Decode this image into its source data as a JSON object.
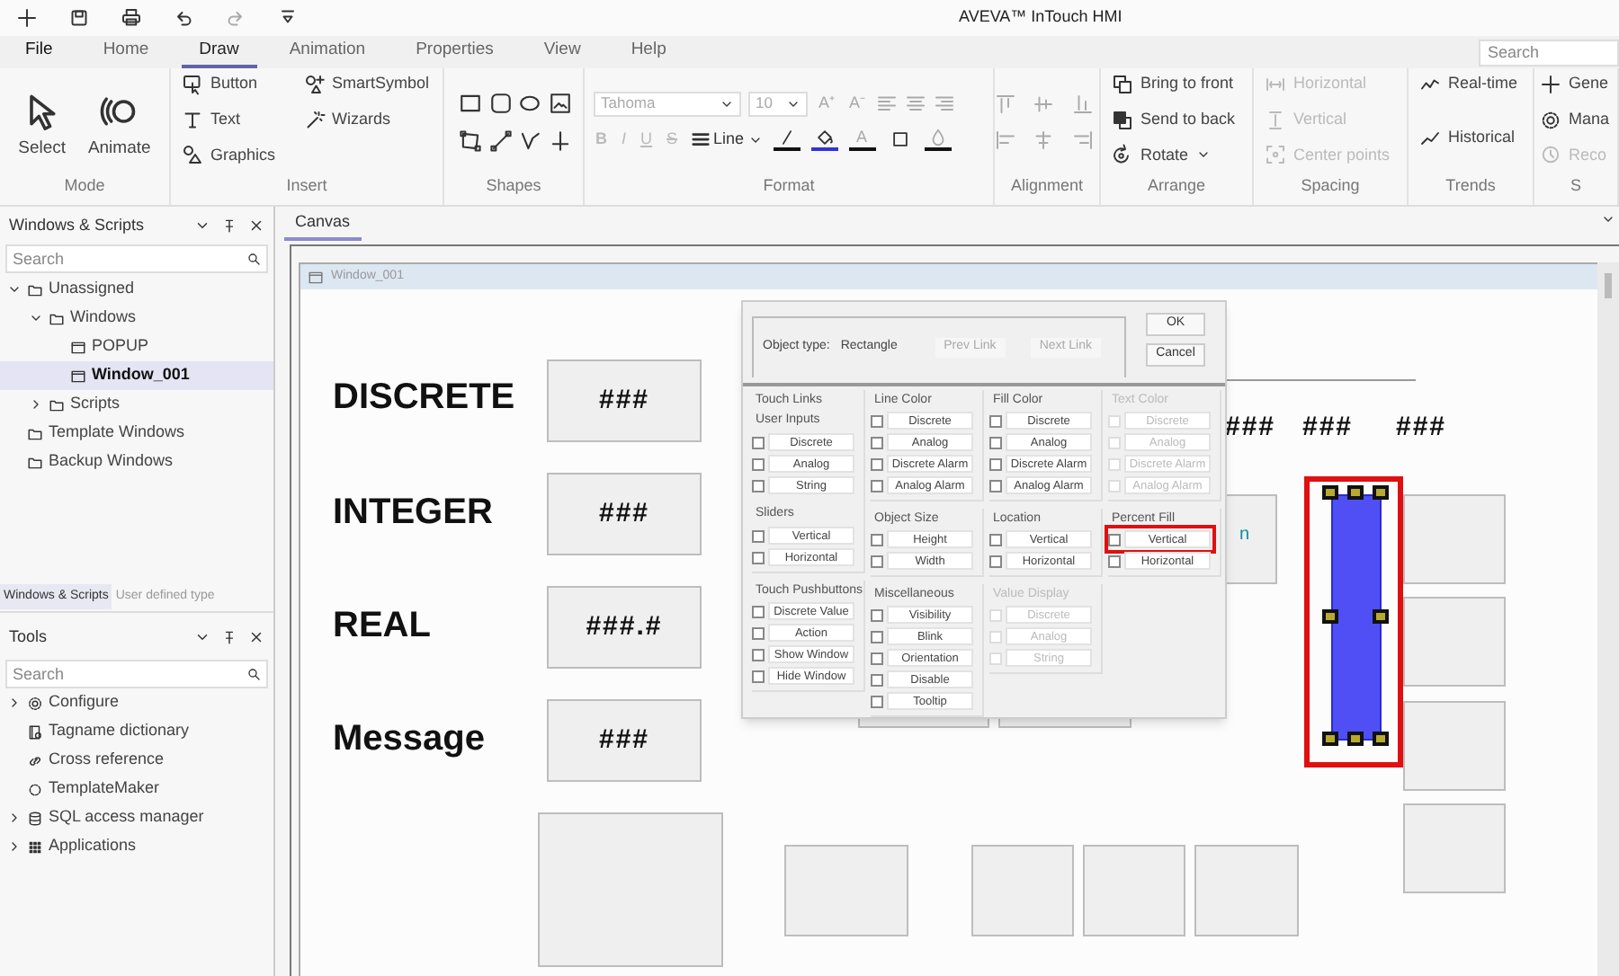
{
  "title": "AVEVA™ InTouch HMI",
  "menu_tabs": [
    {
      "label": "File",
      "selected": false
    },
    {
      "label": "Home",
      "selected": false
    },
    {
      "label": "Draw",
      "selected": true
    },
    {
      "label": "Animation",
      "selected": false
    },
    {
      "label": "Properties",
      "selected": false
    },
    {
      "label": "View",
      "selected": false
    },
    {
      "label": "Help",
      "selected": false
    }
  ],
  "ribbon_search": {
    "placeholder": "Search"
  },
  "ribbon_groups": [
    {
      "label": "Mode",
      "kind": "big",
      "items": [
        {
          "label": "Select",
          "disabled": false
        },
        {
          "label": "Animate",
          "disabled": false
        }
      ]
    },
    {
      "label": "Insert",
      "kind": "list2",
      "items": [
        {
          "label": "Button",
          "disabled": false
        },
        {
          "label": "Text",
          "disabled": false
        },
        {
          "label": "Graphics",
          "disabled": false
        },
        {
          "label": "SmartSymbol",
          "disabled": false
        },
        {
          "label": "Wizards",
          "disabled": false
        }
      ]
    },
    {
      "label": "Shapes",
      "kind": "shapes"
    },
    {
      "label": "Format",
      "kind": "format",
      "font": "Tahoma",
      "size": "10",
      "font_size_buttons": [
        "A⁺",
        "A⁻"
      ],
      "style_buttons": [
        "B",
        "I",
        "U",
        "S"
      ],
      "line": "Line",
      "text_color_button": "A"
    },
    {
      "label": "Alignment",
      "kind": "align"
    },
    {
      "label": "Arrange",
      "kind": "list",
      "items": [
        {
          "label": "Bring to front",
          "disabled": false
        },
        {
          "label": "Send to back",
          "disabled": false
        },
        {
          "label": "Rotate",
          "disabled": false
        }
      ]
    },
    {
      "label": "Spacing",
      "kind": "list",
      "items": [
        {
          "label": "Horizontal",
          "disabled": true
        },
        {
          "label": "Vertical",
          "disabled": true
        },
        {
          "label": "Center points",
          "disabled": true
        }
      ]
    },
    {
      "label": "Trends",
      "kind": "list",
      "items": [
        {
          "label": "Real-time",
          "disabled": false
        },
        {
          "label": "Historical",
          "disabled": false
        }
      ]
    },
    {
      "label": "S",
      "kind": "list",
      "items": [
        {
          "label": "Gene",
          "disabled": false
        },
        {
          "label": "Mana",
          "disabled": false
        },
        {
          "label": "Reco",
          "disabled": true
        }
      ]
    }
  ],
  "windows_panel": {
    "title": "Windows & Scripts",
    "search": {
      "placeholder": "Search"
    },
    "tree": [
      {
        "label": "Unassigned",
        "expanded": true,
        "selected": false,
        "children": [
          {
            "label": "Windows",
            "expanded": true,
            "selected": false,
            "children": [
              {
                "label": "POPUP",
                "selected": false
              },
              {
                "label": "Window_001",
                "selected": true
              }
            ]
          },
          {
            "label": "Scripts",
            "expanded": false,
            "selected": false
          }
        ]
      },
      {
        "label": "Template Windows",
        "selected": false
      },
      {
        "label": "Backup Windows",
        "selected": false
      }
    ],
    "tabs": [
      {
        "label": "Windows & Scripts",
        "selected": true
      },
      {
        "label": "User defined type",
        "selected": false
      }
    ]
  },
  "tools_panel": {
    "title": "Tools",
    "search": {
      "placeholder": "Search"
    },
    "items": [
      {
        "label": "Configure",
        "expanded": false
      },
      {
        "label": "Tagname dictionary"
      },
      {
        "label": "Cross reference"
      },
      {
        "label": "TemplateMaker"
      },
      {
        "label": "SQL access manager",
        "expanded": false
      },
      {
        "label": "Applications",
        "expanded": false
      }
    ]
  },
  "canvas_tab": {
    "label": "Canvas"
  },
  "window": {
    "title": "Window_001"
  },
  "objects": [
    {
      "kind": "label",
      "text": "DISCRETE",
      "selected": false
    },
    {
      "kind": "label",
      "text": "INTEGER",
      "selected": false
    },
    {
      "kind": "label",
      "text": "REAL",
      "selected": false
    },
    {
      "kind": "label",
      "text": "Message",
      "selected": false
    },
    {
      "kind": "box",
      "text": "###",
      "selected": false
    },
    {
      "kind": "box",
      "text": "###",
      "selected": false
    },
    {
      "kind": "box",
      "text": "###.#",
      "selected": false
    },
    {
      "kind": "box",
      "text": "###",
      "selected": false
    },
    {
      "kind": "value",
      "text": "###",
      "selected": false
    },
    {
      "kind": "value",
      "text": "###",
      "selected": false
    },
    {
      "kind": "value",
      "text": "###",
      "selected": false
    },
    {
      "kind": "line",
      "selected": false
    },
    {
      "kind": "box",
      "selected": false
    },
    {
      "kind": "caption",
      "text": "n",
      "selected": false
    },
    {
      "kind": "bar",
      "selected": true
    },
    {
      "kind": "highlight"
    },
    {
      "kind": "box",
      "selected": false
    },
    {
      "kind": "box",
      "selected": false
    },
    {
      "kind": "box",
      "selected": false
    },
    {
      "kind": "box",
      "selected": false
    },
    {
      "kind": "box",
      "selected": false
    },
    {
      "kind": "box",
      "selected": false
    },
    {
      "kind": "box",
      "selected": false
    },
    {
      "kind": "box",
      "selected": false
    },
    {
      "kind": "box",
      "selected": false
    },
    {
      "kind": "box",
      "selected": false
    },
    {
      "kind": "box",
      "selected": false
    }
  ],
  "link_dialog": {
    "object_type_label": "Object type:",
    "object_type": "Rectangle",
    "buttons": [
      {
        "label": "Prev Link",
        "disabled": true
      },
      {
        "label": "Next Link",
        "disabled": true
      },
      {
        "label": "OK",
        "disabled": false
      },
      {
        "label": "Cancel",
        "disabled": false
      }
    ],
    "columns": [
      [
        {
          "title": "Touch Links",
          "disabled": false,
          "sections": [
            {
              "subtitle": "User Inputs",
              "items": [
                {
                  "label": "Discrete",
                  "checked": false
                },
                {
                  "label": "Analog",
                  "checked": false
                },
                {
                  "label": "String",
                  "checked": false
                }
              ]
            },
            {
              "subtitle": "Sliders",
              "items": [
                {
                  "label": "Vertical",
                  "checked": false
                },
                {
                  "label": "Horizontal",
                  "checked": false
                }
              ]
            }
          ]
        },
        {
          "title": "Touch Pushbuttons",
          "disabled": false,
          "sections": [
            {
              "items": [
                {
                  "label": "Discrete Value",
                  "checked": false
                },
                {
                  "label": "Action",
                  "checked": false
                },
                {
                  "label": "Show Window",
                  "checked": false
                },
                {
                  "label": "Hide Window",
                  "checked": false
                }
              ]
            }
          ]
        }
      ],
      [
        {
          "title": "Line Color",
          "disabled": false,
          "sections": [
            {
              "items": [
                {
                  "label": "Discrete",
                  "checked": false
                },
                {
                  "label": "Analog",
                  "checked": false
                },
                {
                  "label": "Discrete Alarm",
                  "checked": false
                },
                {
                  "label": "Analog Alarm",
                  "checked": false
                }
              ]
            }
          ]
        },
        {
          "title": "Object Size",
          "disabled": false,
          "sections": [
            {
              "items": [
                {
                  "label": "Height",
                  "checked": false
                },
                {
                  "label": "Width",
                  "checked": false
                }
              ]
            }
          ]
        },
        {
          "title": "Miscellaneous",
          "disabled": false,
          "sections": [
            {
              "items": [
                {
                  "label": "Visibility",
                  "checked": false
                },
                {
                  "label": "Blink",
                  "checked": false
                },
                {
                  "label": "Orientation",
                  "checked": false
                },
                {
                  "label": "Disable",
                  "checked": false
                },
                {
                  "label": "Tooltip",
                  "checked": false
                }
              ]
            }
          ]
        }
      ],
      [
        {
          "title": "Fill Color",
          "disabled": false,
          "sections": [
            {
              "items": [
                {
                  "label": "Discrete",
                  "checked": false
                },
                {
                  "label": "Analog",
                  "checked": false
                },
                {
                  "label": "Discrete Alarm",
                  "checked": false
                },
                {
                  "label": "Analog Alarm",
                  "checked": false
                }
              ]
            }
          ]
        },
        {
          "title": "Location",
          "disabled": false,
          "sections": [
            {
              "items": [
                {
                  "label": "Vertical",
                  "checked": false
                },
                {
                  "label": "Horizontal",
                  "checked": false
                }
              ]
            }
          ]
        },
        {
          "title": "Value Display",
          "disabled": true,
          "sections": [
            {
              "items": [
                {
                  "label": "Discrete",
                  "checked": false
                },
                {
                  "label": "Analog",
                  "checked": false
                },
                {
                  "label": "String",
                  "checked": false
                }
              ]
            }
          ]
        }
      ],
      [
        {
          "title": "Text Color",
          "disabled": true,
          "sections": [
            {
              "items": [
                {
                  "label": "Discrete",
                  "checked": false
                },
                {
                  "label": "Analog",
                  "checked": false
                },
                {
                  "label": "Discrete Alarm",
                  "checked": false
                },
                {
                  "label": "Analog Alarm",
                  "checked": false
                }
              ]
            }
          ]
        },
        {
          "title": "Percent Fill",
          "disabled": false,
          "sections": [
            {
              "items": [
                {
                  "label": "Vertical",
                  "checked": false,
                  "highlighted": true
                },
                {
                  "label": "Horizontal",
                  "checked": false
                }
              ]
            }
          ]
        }
      ]
    ]
  }
}
